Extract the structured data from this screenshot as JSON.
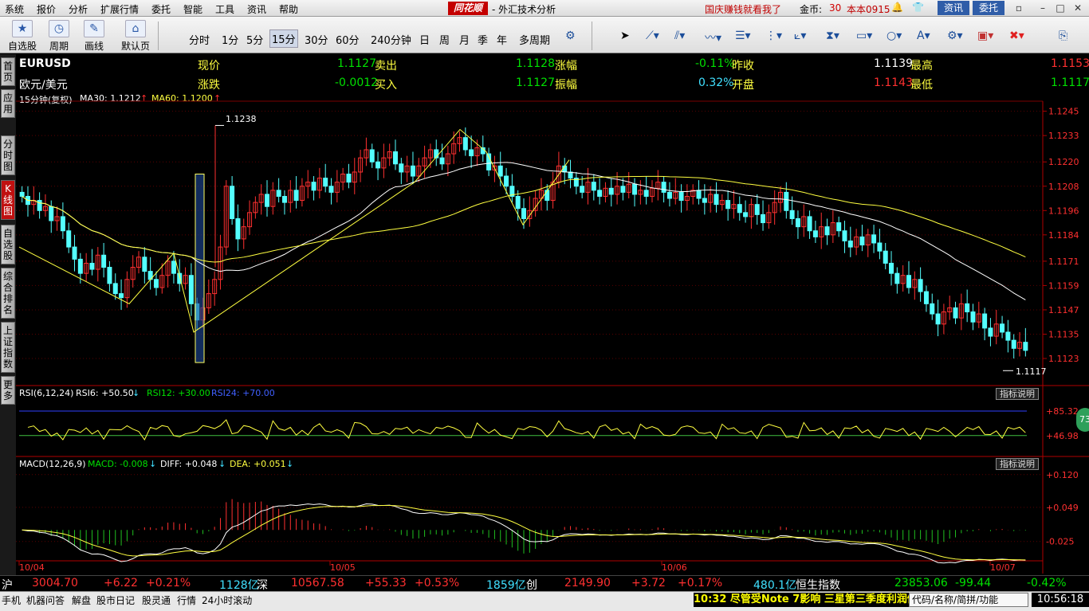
{
  "menu": {
    "items": [
      "系统",
      "报价",
      "分析",
      "扩展行情",
      "委托",
      "智能",
      "工具",
      "资讯",
      "帮助"
    ],
    "logo": "同花顺",
    "title": "- 外汇技术分析",
    "promo": "国庆赚钱就看我了",
    "coin_label": "金币:",
    "coin_value": "30",
    "version": "本本0915",
    "news_btn": "资讯",
    "trade_btn": "委托"
  },
  "toolbar": {
    "buttons": [
      "自选股",
      "周期",
      "画线",
      "默认页"
    ],
    "periods": [
      "分时",
      "1分",
      "5分",
      "15分",
      "30分",
      "60分",
      "240分钟",
      "日",
      "周",
      "月",
      "季",
      "年",
      "多周期"
    ],
    "selected_period": "15分"
  },
  "sidebar": {
    "tabs": [
      "首页",
      "应用",
      "分时图",
      "K线图",
      "自选股",
      "综合排名",
      "上证指数",
      "更多"
    ],
    "active": "K线图"
  },
  "quote": {
    "symbol": "EURUSD",
    "name": "欧元/美元",
    "now_label": "现价",
    "now": "1.1127",
    "sell_label": "卖出",
    "sell": "1.1128",
    "pct_label": "涨幅",
    "pct": "-0.11%",
    "prev_label": "昨收",
    "prev": "1.1139",
    "high_label": "最高",
    "high": "1.1153",
    "chg_label": "涨跌",
    "chg": "-0.0012",
    "buy_label": "买入",
    "buy": "1.1127",
    "amp_label": "振幅",
    "amp": "0.32%",
    "open_label": "开盘",
    "open": "1.1143",
    "low_label": "最低",
    "low": "1.1117"
  },
  "chart_head": {
    "period": "15分钟(复权)",
    "ma30": "MA30: 1.1212",
    "ma60": "MA60: 1.1200",
    "peak_label": "1.1238",
    "trough_label": "1.1117"
  },
  "rsi_head": {
    "name": "RSI(6,12,24)",
    "rsi6": "RSI6: +50.50",
    "rsi12": "RSI12: +30.00",
    "rsi24": "RSI24: +70.00",
    "explain": "指标说明"
  },
  "macd_head": {
    "name": "MACD(12,26,9)",
    "macd": "MACD: -0.008",
    "diff": "DIFF: +0.048",
    "dea": "DEA: +0.051",
    "explain": "指标说明"
  },
  "status": {
    "sh": "沪",
    "sh_val": "3004.70",
    "sh_chg": "+6.22",
    "sh_pct": "+0.21%",
    "sh_amt": "1128亿",
    "sz": "深",
    "sz_val": "10567.58",
    "sz_chg": "+55.33",
    "sz_pct": "+0.53%",
    "sz_amt": "1859亿",
    "cy": "创",
    "cy_val": "2149.90",
    "cy_chg": "+3.72",
    "cy_pct": "+0.17%",
    "cy_amt": "480.1亿",
    "hs": "恒生指数",
    "hs_val": "23853.06",
    "hs_chg": "-99.44",
    "hs_pct": "-0.42%"
  },
  "bottom": {
    "items": [
      "手机",
      "机器问答",
      "解盘",
      "股市日记",
      "股灵通",
      "行情",
      "24小时滚动"
    ],
    "ticker": "10:32 尽管受Note 7影响 三星第三季度利润仍",
    "search_placeholder": "代码/名称/简拼/功能",
    "clock": "10:56:18",
    "badge": "73"
  },
  "chart_data": {
    "type": "candlestick",
    "x_labels": [
      "10/04",
      "10/05",
      "10/06",
      "10/07"
    ],
    "y_ticks": [
      "1.1245",
      "1.1233",
      "1.1220",
      "1.1208",
      "1.1196",
      "1.1184",
      "1.1171",
      "1.1159",
      "1.1147",
      "1.1135",
      "1.1123"
    ],
    "rsi_ticks": [
      "+85.32",
      "+46.98"
    ],
    "macd_ticks": [
      "+0.120",
      "+0.049",
      "-0.025"
    ],
    "ylim": [
      1.1112,
      1.1248
    ],
    "close": [
      1.1203,
      1.1199,
      1.1201,
      1.1196,
      1.1198,
      1.1191,
      1.1193,
      1.1186,
      1.1178,
      1.1172,
      1.1165,
      1.117,
      1.1167,
      1.1174,
      1.1168,
      1.116,
      1.1155,
      1.1153,
      1.1162,
      1.1168,
      1.1173,
      1.1166,
      1.1162,
      1.1158,
      1.1164,
      1.1171,
      1.1165,
      1.116,
      1.1164,
      1.115,
      1.1142,
      1.1148,
      1.1155,
      1.1162,
      1.1178,
      1.1208,
      1.1192,
      1.1182,
      1.1188,
      1.1195,
      1.12,
      1.1204,
      1.1198,
      1.1206,
      1.1203,
      1.12,
      1.1206,
      1.1201,
      1.1208,
      1.121,
      1.1206,
      1.1212,
      1.1208,
      1.1205,
      1.121,
      1.1214,
      1.121,
      1.1215,
      1.1222,
      1.1226,
      1.122,
      1.1217,
      1.1222,
      1.1225,
      1.1219,
      1.1215,
      1.1218,
      1.1213,
      1.1218,
      1.1222,
      1.1226,
      1.1222,
      1.1219,
      1.1224,
      1.1229,
      1.1232,
      1.1226,
      1.1223,
      1.1227,
      1.1224,
      1.1216,
      1.1218,
      1.1213,
      1.1208,
      1.1203,
      1.1197,
      1.1192,
      1.1196,
      1.1202,
      1.1206,
      1.1201,
      1.121,
      1.1218,
      1.1215,
      1.1212,
      1.1208,
      1.1205,
      1.121,
      1.1206,
      1.1203,
      1.1207,
      1.1204,
      1.1208,
      1.1205,
      1.1209,
      1.1204,
      1.1206,
      1.1203,
      1.1207,
      1.121,
      1.1205,
      1.1202,
      1.1205,
      1.1201,
      1.1203,
      1.1206,
      1.1202,
      1.12,
      1.1204,
      1.1199,
      1.1201,
      1.1197,
      1.1199,
      1.1195,
      1.1193,
      1.1199,
      1.1194,
      1.119,
      1.1195,
      1.12,
      1.1205,
      1.1196,
      1.1192,
      1.1188,
      1.1193,
      1.1186,
      1.1183,
      1.1188,
      1.1184,
      1.119,
      1.1186,
      1.1181,
      1.1178,
      1.1183,
      1.1179,
      1.1184,
      1.118,
      1.1176,
      1.117,
      1.1165,
      1.116,
      1.1164,
      1.1158,
      1.1162,
      1.1156,
      1.115,
      1.1145,
      1.114,
      1.1146,
      1.1148,
      1.1143,
      1.115,
      1.1146,
      1.1141,
      1.1145,
      1.1138,
      1.1134,
      1.114,
      1.1136,
      1.1132,
      1.1128,
      1.1131,
      1.1127
    ]
  }
}
